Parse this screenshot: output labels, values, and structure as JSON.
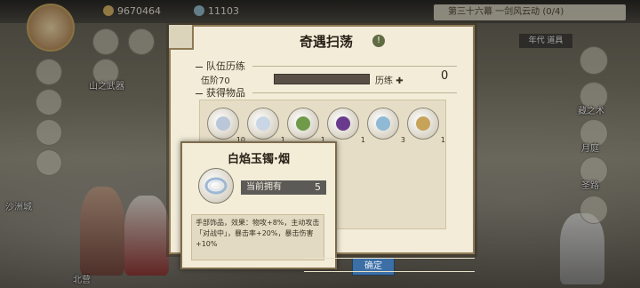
{
  "topbar": {
    "coins": "9670464",
    "jade": "11103"
  },
  "quest": {
    "text": "第三十六幕 一剑风云动 (0/4)"
  },
  "right_side": {
    "era_label": "年代 道具",
    "lbl_1": "藏之术",
    "lbl_2": "月庭",
    "lbl_3": "圣路"
  },
  "dialog": {
    "title": "奇遇扫荡",
    "info_icon": "!",
    "section_team": "队伍历练",
    "rank_text": "伍阶70",
    "exp_label": "历练",
    "exp_value": "0",
    "exp_progress": 0,
    "section_items": "获得物品",
    "items": [
      {
        "name": "item-star-charm",
        "count": "10",
        "gem": "#b9c7d9"
      },
      {
        "name": "item-jade-bracelet",
        "count": "1",
        "gem": "#c8d6e6"
      },
      {
        "name": "item-green-pendant",
        "count": "1",
        "gem": "#6f9a4a"
      },
      {
        "name": "item-purple-cushion",
        "count": "1",
        "gem": "#6a3b8c"
      },
      {
        "name": "item-blue-cloud",
        "count": "3",
        "gem": "#8fb9d4"
      },
      {
        "name": "item-gold-ornament",
        "count": "1",
        "gem": "#c7a35a"
      }
    ]
  },
  "popup": {
    "title": "白焰玉镯·烟",
    "owned_label": "当前拥有",
    "owned_count": "5",
    "description": "手部饰品，效果：物攻+8%，主动攻击「对战中」，暴击率+20%，暴击伤害+10%"
  },
  "bottom": {
    "button_label": "确定"
  },
  "left_labels": {
    "skill": "山之武器",
    "zone": "沙洲城",
    "base": "北营"
  },
  "colors": {
    "dialog_bg": "#f2ecd9",
    "border": "#8f7a55",
    "button": "#3c6fa6"
  }
}
